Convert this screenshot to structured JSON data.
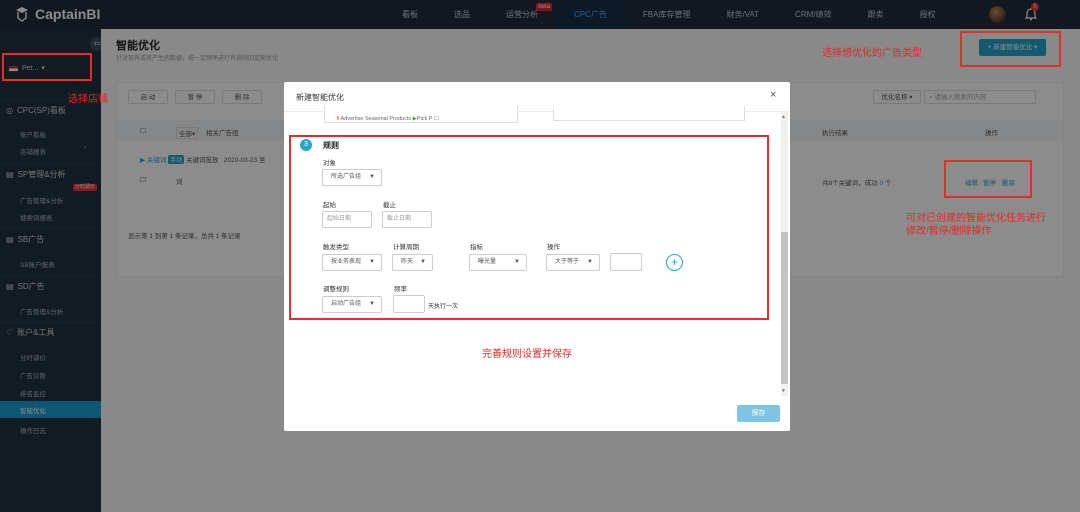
{
  "header": {
    "brand": "CaptainBI",
    "nav": [
      {
        "label": "看板"
      },
      {
        "label": "选品"
      },
      {
        "label": "运营分析",
        "badge": "beta"
      },
      {
        "label": "CPC广告",
        "active": true
      },
      {
        "label": "FBA库存管理"
      },
      {
        "label": "财务/VAT"
      },
      {
        "label": "CRM/绩效"
      },
      {
        "label": "跟卖"
      },
      {
        "label": "授权"
      }
    ],
    "notification_count": "5"
  },
  "sidebar": {
    "store_name": "Pet...",
    "groups": {
      "cpc": "CPC(SP)看板",
      "sp": "SP管理&分析",
      "sb": "SB广告",
      "sd": "SD广告",
      "account": "账户&工具"
    },
    "items": {
      "account_board": "账户看板",
      "store_report": "店铺报表",
      "ad_manage": "广告管理&分析",
      "search_report": "搜索词报表",
      "sb_report": "SB账户报表",
      "sd_manage": "广告管理&分析",
      "timing": "分时调价",
      "diagnose": "广告诊断",
      "rank_monitor": "排名监控",
      "smart": "智能优化",
      "logs": "操作日志"
    },
    "sp_badge": "分时调价"
  },
  "page": {
    "title": "智能优化",
    "description": "针对现有或将产生的数据，按一定频率进行有规则的定期优化",
    "new_button": "+ 新建智能优化 ▾",
    "toolbar": {
      "enable": "启 动",
      "pause": "暂 停",
      "delete": "删 除"
    },
    "search_select": "优化名称",
    "search_placeholder": "请输入搜索的内容"
  },
  "table": {
    "head_all": "全部",
    "head_rel": "相关广告组",
    "head_result": "执行结果",
    "head_ops": "操作",
    "row": {
      "type": "关键词",
      "mode": "手动",
      "name": "关键词投放",
      "date": "2020-03-23 至",
      "sub": "词",
      "result_prefix": "共8个关键词，成功",
      "result_count": "0",
      "result_suffix": "个",
      "ops": [
        "编辑",
        "暂停",
        "删除"
      ]
    },
    "footer": "显示第 1 到第 1 条记录，总共 1 条记录"
  },
  "modal": {
    "title": "新建智能优化",
    "close": "×",
    "prev_row_text": "Advertise Seasonal Products",
    "prev_row_text2": "Pick P",
    "step": "3",
    "section_title": "规则",
    "object_label": "对象",
    "object_value": "所选广告组",
    "start_label": "起始",
    "start_placeholder": "起始日期",
    "end_label": "截止",
    "end_placeholder": "截止日期",
    "trigger_label": "触发类型",
    "trigger_value": "按业务表现",
    "period_label": "计算周期",
    "period_value": "昨天",
    "metric_label": "指标",
    "metric_value": "曝光量",
    "op_label": "操作",
    "op_value": "大于等于",
    "plus": "+",
    "adjust_label": "调整规则",
    "adjust_value": "启动广告组",
    "freq_label": "频率",
    "freq_suffix": "天执行一次",
    "save": "保存"
  },
  "annotations": {
    "select_store": "选择店铺",
    "select_type": "选择想优化的广告类型",
    "ops_hint": [
      "可对已创建的智能优化任务进行",
      "修改/暂停/删除操作"
    ],
    "complete_rules": "完善规则设置并保存"
  },
  "colors": {
    "topbar": "#1f2d3a",
    "sidebar": "#22313f",
    "accent": "#26a5c9",
    "annotation_red": "#e02a24"
  }
}
